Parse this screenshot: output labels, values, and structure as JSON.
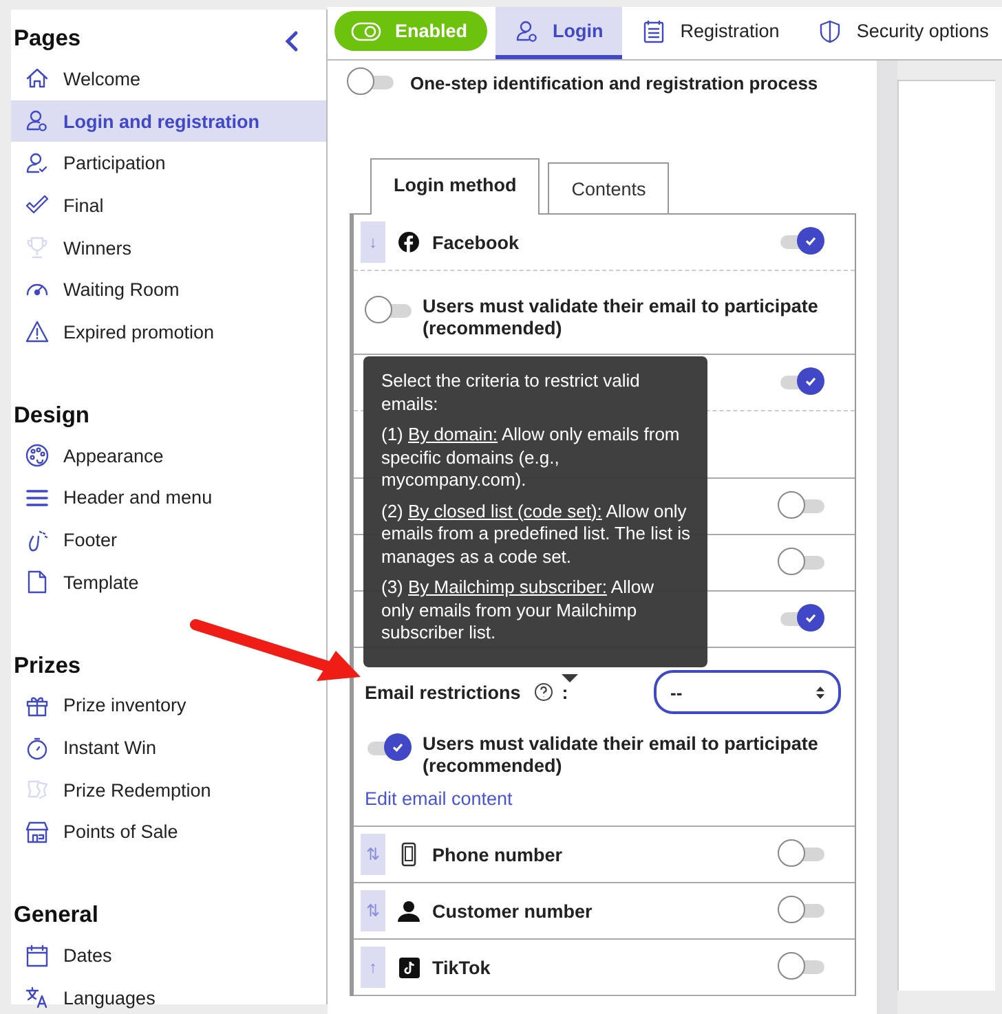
{
  "sidebar": {
    "sections": [
      {
        "title": "Pages",
        "items": [
          {
            "label": "Welcome",
            "selected": false,
            "dimmed_icon": false
          },
          {
            "label": "Login and registration",
            "selected": true,
            "dimmed_icon": false
          },
          {
            "label": "Participation",
            "selected": false,
            "dimmed_icon": false
          },
          {
            "label": "Final",
            "selected": false,
            "dimmed_icon": false
          },
          {
            "label": "Winners",
            "selected": false,
            "dimmed_icon": true
          },
          {
            "label": "Waiting Room",
            "selected": false,
            "dimmed_icon": false
          },
          {
            "label": "Expired promotion",
            "selected": false,
            "dimmed_icon": false
          }
        ]
      },
      {
        "title": "Design",
        "items": [
          {
            "label": "Appearance",
            "selected": false,
            "dimmed_icon": false
          },
          {
            "label": "Header and menu",
            "selected": false,
            "dimmed_icon": false
          },
          {
            "label": "Footer",
            "selected": false,
            "dimmed_icon": false
          },
          {
            "label": "Template",
            "selected": false,
            "dimmed_icon": false
          }
        ]
      },
      {
        "title": "Prizes",
        "items": [
          {
            "label": "Prize inventory",
            "selected": false,
            "dimmed_icon": false
          },
          {
            "label": "Instant Win",
            "selected": false,
            "dimmed_icon": false
          },
          {
            "label": "Prize Redemption",
            "selected": false,
            "dimmed_icon": true
          },
          {
            "label": "Points of Sale",
            "selected": false,
            "dimmed_icon": false
          }
        ]
      },
      {
        "title": "General",
        "items": [
          {
            "label": "Dates",
            "selected": false,
            "dimmed_icon": false
          },
          {
            "label": "Languages",
            "selected": false,
            "dimmed_icon": false
          }
        ]
      }
    ]
  },
  "status_toggle": {
    "label": "Enabled",
    "on": true
  },
  "top_tabs": [
    {
      "label": "Login",
      "selected": true
    },
    {
      "label": "Registration",
      "selected": false
    },
    {
      "label": "Security options",
      "selected": false
    }
  ],
  "one_step": {
    "label": "One-step identification and registration process",
    "on": false
  },
  "method_tabs": [
    {
      "label": "Login method",
      "selected": true
    },
    {
      "label": "Contents",
      "selected": false
    }
  ],
  "methods": [
    {
      "kind": "method",
      "handle": "↓",
      "label": "Facebook",
      "on": true
    },
    {
      "kind": "validate",
      "label": "Users must validate their email to participate (recommended)",
      "on": false
    },
    {
      "kind": "covered",
      "on": true
    },
    {
      "kind": "covered_validate"
    },
    {
      "kind": "covered",
      "on": false
    },
    {
      "kind": "covered",
      "on": false
    },
    {
      "kind": "covered",
      "on": true
    },
    {
      "kind": "email_settings",
      "restriction_label": "Email restrictions",
      "restriction_colon": ":",
      "restriction_value": "--",
      "validate_label": "Users must validate their email to participate (recommended)",
      "validate_on": true,
      "link": "Edit email content"
    },
    {
      "kind": "method",
      "handle": "⇅",
      "label": "Phone number",
      "on": false
    },
    {
      "kind": "method",
      "handle": "⇅",
      "label": "Customer number",
      "on": false
    },
    {
      "kind": "method",
      "handle": "↑",
      "label": "TikTok",
      "on": false
    }
  ],
  "tooltip": {
    "intro": "Select the criteria to restrict valid emails:",
    "items": [
      {
        "number": "(1)",
        "term": "By domain:",
        "text": "Allow only emails from specific domains (e.g., mycompany.com)."
      },
      {
        "number": "(2)",
        "term": "By closed list (code set):",
        "text": "Allow only emails from a predefined list. The list is manages as a code set."
      },
      {
        "number": "(3)",
        "term": "By Mailchimp subscriber:",
        "text": "Allow only emails from your Mailchimp subscriber list."
      }
    ]
  }
}
